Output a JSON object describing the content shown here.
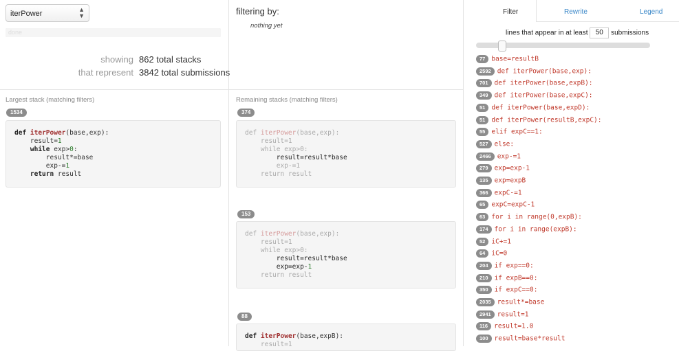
{
  "function_select": {
    "value": "iterPower"
  },
  "progress": {
    "label": "done",
    "fraction": 1.0
  },
  "stats": {
    "showing_label": "showing",
    "showing_value": "862 total stacks",
    "represent_label": "that represent",
    "represent_value": "3842 total submissions"
  },
  "filter_panel": {
    "title": "filtering by:",
    "empty": "nothing yet"
  },
  "largest": {
    "title": "Largest stack (matching filters)",
    "count": "1534"
  },
  "remaining": {
    "title": "Remaining stacks (matching filters)",
    "stacks": [
      {
        "count": "374"
      },
      {
        "count": "153"
      },
      {
        "count": "88"
      }
    ]
  },
  "tabs": {
    "filter": "Filter",
    "rewrite": "Rewrite",
    "legend": "Legend"
  },
  "threshold": {
    "prefix": "lines that appear in at least",
    "value": "50",
    "suffix": "submissions"
  },
  "lines": [
    {
      "count": "77",
      "text": "base=resultB"
    },
    {
      "count": "2592",
      "text": "def iterPower(base,exp):"
    },
    {
      "count": "701",
      "text": "def iterPower(base,expB):"
    },
    {
      "count": "349",
      "text": "def iterPower(base,expC):"
    },
    {
      "count": "51",
      "text": "def iterPower(base,expD):"
    },
    {
      "count": "51",
      "text": "def iterPower(resultB,expC):"
    },
    {
      "count": "55",
      "text": "elif expC==1:"
    },
    {
      "count": "527",
      "text": "else:"
    },
    {
      "count": "2466",
      "text": "exp-=1"
    },
    {
      "count": "279",
      "text": "exp=exp-1"
    },
    {
      "count": "135",
      "text": "exp=expB"
    },
    {
      "count": "366",
      "text": "expC-=1"
    },
    {
      "count": "65",
      "text": "expC=expC-1"
    },
    {
      "count": "63",
      "text": "for i in range(0,expB):"
    },
    {
      "count": "174",
      "text": "for i in range(expB):"
    },
    {
      "count": "52",
      "text": "iC+=1"
    },
    {
      "count": "64",
      "text": "iC=0"
    },
    {
      "count": "204",
      "text": "if exp==0:"
    },
    {
      "count": "210",
      "text": "if expB==0:"
    },
    {
      "count": "350",
      "text": "if expC==0:"
    },
    {
      "count": "2035",
      "text": "result*=base"
    },
    {
      "count": "2941",
      "text": "result=1"
    },
    {
      "count": "116",
      "text": "result=1.0"
    },
    {
      "count": "100",
      "text": "result=base*result"
    }
  ]
}
